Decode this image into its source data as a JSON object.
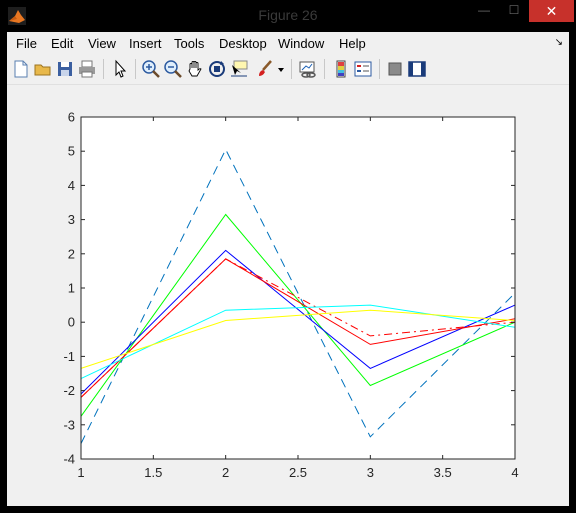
{
  "window": {
    "title": "Figure 26",
    "minimize_glyph": "—",
    "maximize_glyph": "☐",
    "close_glyph": "✕"
  },
  "menu": {
    "items": [
      "File",
      "Edit",
      "View",
      "Insert",
      "Tools",
      "Desktop",
      "Window",
      "Help"
    ],
    "dock_arrow": "↘"
  },
  "toolbar": {
    "icons": [
      "new-figure-icon",
      "open-file-icon",
      "save-icon",
      "print-icon",
      "edit-plot-arrow-icon",
      "zoom-in-icon",
      "zoom-out-icon",
      "pan-hand-icon",
      "rotate-3d-icon",
      "data-cursor-icon",
      "brush-icon",
      "brush-dropdown-icon",
      "link-plot-icon",
      "insert-colorbar-icon",
      "insert-legend-icon",
      "hide-plot-tools-icon",
      "show-plot-tools-icon"
    ]
  },
  "chart_data": {
    "type": "line",
    "title": "",
    "xlabel": "",
    "ylabel": "",
    "xlim": [
      1,
      4
    ],
    "ylim": [
      -4,
      6
    ],
    "x_ticks": [
      "1",
      "1.5",
      "2",
      "2.5",
      "3",
      "3.5",
      "4"
    ],
    "y_ticks": [
      "6",
      "5",
      "4",
      "3",
      "2",
      "1",
      "0",
      "-1",
      "-2",
      "-3",
      "-4"
    ],
    "grid": false,
    "x": [
      1,
      2,
      3,
      4
    ],
    "series": [
      {
        "values": [
          -3.55,
          5.05,
          -3.35,
          0.85
        ],
        "color": "#0072bd",
        "dash": "dashed"
      },
      {
        "values": [
          -2.75,
          3.15,
          -1.85,
          0.0
        ],
        "color": "#00ff00",
        "dash": "solid"
      },
      {
        "values": [
          -2.1,
          2.1,
          -1.35,
          0.5
        ],
        "color": "#0000ff",
        "dash": "solid"
      },
      {
        "values": [
          -2.2,
          1.85,
          -0.65,
          0.1
        ],
        "color": "#ff0000",
        "dash": "solid"
      },
      {
        "values": [
          -2.2,
          1.85,
          -0.4,
          0.0
        ],
        "color": "#ff0000",
        "dash": "dashdot"
      },
      {
        "values": [
          -1.65,
          0.35,
          0.5,
          -0.15
        ],
        "color": "#00ffff",
        "dash": "solid"
      },
      {
        "values": [
          -1.35,
          0.05,
          0.35,
          0.05
        ],
        "color": "#ffff00",
        "dash": "solid"
      }
    ]
  }
}
